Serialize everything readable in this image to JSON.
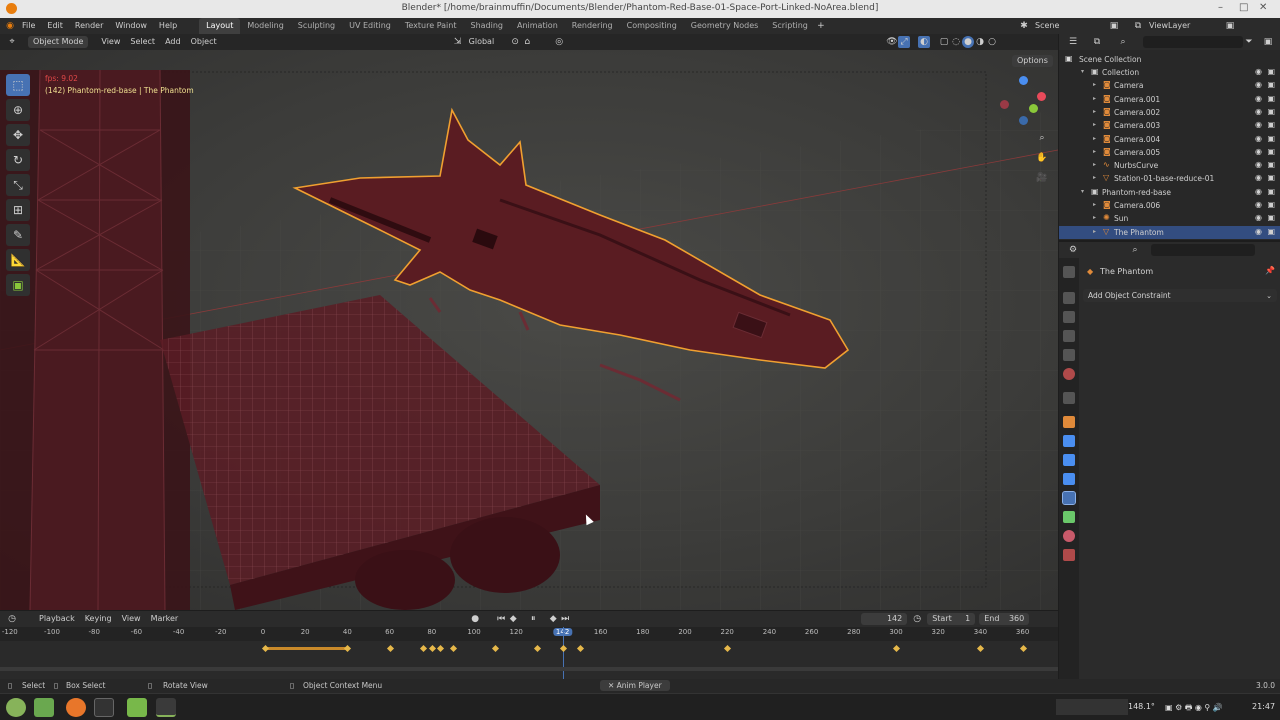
{
  "window": {
    "title": "Blender* [/home/brainmuffin/Documents/Blender/Phantom-Red-Base-01-Space-Port-Linked-NoArea.blend]",
    "controls": [
      "–",
      "□",
      "✕"
    ]
  },
  "menu": [
    "File",
    "Edit",
    "Render",
    "Window",
    "Help"
  ],
  "workspaces": [
    "Layout",
    "Modeling",
    "Sculpting",
    "UV Editing",
    "Texture Paint",
    "Shading",
    "Animation",
    "Rendering",
    "Compositing",
    "Geometry Nodes",
    "Scripting"
  ],
  "active_workspace": "Layout",
  "scene": {
    "label": "Scene",
    "view_layer": "ViewLayer"
  },
  "viewport_header": {
    "mode": "Object Mode",
    "menus": [
      "View",
      "Select",
      "Add",
      "Object"
    ],
    "transform": "Global",
    "options": "Options"
  },
  "viewport_overlay": {
    "fps": "fps: 9.02",
    "object_info": "(142) Phantom-red-base | The Phantom"
  },
  "timeline": {
    "menus": [
      "Playback",
      "Keying",
      "View",
      "Marker"
    ],
    "current_frame": "142",
    "start_label": "Start",
    "start": "1",
    "end_label": "End",
    "end": "360",
    "ticks": [
      "-120",
      "-100",
      "-80",
      "-60",
      "-40",
      "-20",
      "0",
      "20",
      "40",
      "60",
      "80",
      "100",
      "120",
      "142",
      "160",
      "180",
      "200",
      "220",
      "240",
      "260",
      "280",
      "300",
      "320",
      "340",
      "360"
    ],
    "keyframes": [
      1,
      40,
      60,
      76,
      80,
      84,
      90,
      110,
      130,
      142,
      150,
      220,
      300,
      340,
      360
    ]
  },
  "status_bar": {
    "select": "Select",
    "box_select": "Box Select",
    "rotate_view": "Rotate View",
    "context_menu": "Object Context Menu",
    "anim_player": "Anim Player",
    "version": "3.0.0"
  },
  "outliner": {
    "root": "Scene Collection",
    "rows": [
      {
        "label": "Collection",
        "depth": 1,
        "icon": "collection-icon",
        "color": "#cfcfcf"
      },
      {
        "label": "Camera",
        "depth": 2,
        "icon": "camera-icon",
        "color": "#e08a3a"
      },
      {
        "label": "Camera.001",
        "depth": 2,
        "icon": "camera-icon",
        "color": "#e08a3a"
      },
      {
        "label": "Camera.002",
        "depth": 2,
        "icon": "camera-icon",
        "color": "#e08a3a"
      },
      {
        "label": "Camera.003",
        "depth": 2,
        "icon": "camera-icon",
        "color": "#e08a3a"
      },
      {
        "label": "Camera.004",
        "depth": 2,
        "icon": "camera-icon",
        "color": "#e08a3a"
      },
      {
        "label": "Camera.005",
        "depth": 2,
        "icon": "camera-icon",
        "color": "#e08a3a"
      },
      {
        "label": "NurbsCurve",
        "depth": 2,
        "icon": "curve-icon",
        "color": "#e08a3a"
      },
      {
        "label": "Station-01-base-reduce-01",
        "depth": 2,
        "icon": "mesh-icon",
        "color": "#e08a3a"
      },
      {
        "label": "Phantom-red-base",
        "depth": 1,
        "icon": "collection-icon",
        "color": "#cfcfcf"
      },
      {
        "label": "Camera.006",
        "depth": 2,
        "icon": "camera-icon",
        "color": "#e08a3a"
      },
      {
        "label": "Sun",
        "depth": 2,
        "icon": "light-icon",
        "color": "#e08a3a"
      },
      {
        "label": "The Phantom",
        "depth": 2,
        "icon": "mesh-icon",
        "color": "#e08a3a",
        "selected": true
      }
    ]
  },
  "properties": {
    "object_name": "The Phantom",
    "add_constraint": "Add Object Constraint"
  },
  "taskbar": {
    "zoom": "148.1°",
    "time": "21:47"
  },
  "colors": {
    "accent": "#4772b3",
    "selection_outline": "#f0a030",
    "ship_body": "#5a1c22",
    "keyframe": "#e6b84a"
  }
}
